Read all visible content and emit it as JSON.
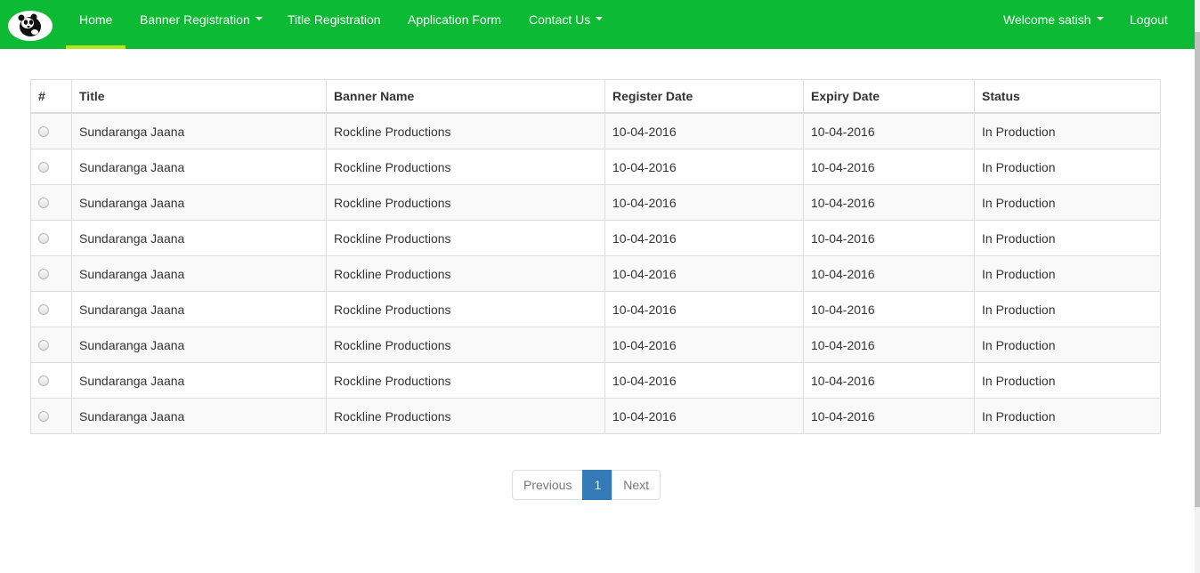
{
  "nav": {
    "logo_icon": "panda-logo-icon",
    "items": [
      {
        "label": "Home",
        "active": true
      },
      {
        "label": "Banner Registration",
        "dropdown": true
      },
      {
        "label": "Title Registration"
      },
      {
        "label": "Application Form"
      },
      {
        "label": "Contact Us",
        "dropdown": true
      }
    ],
    "welcome": "Welcome satish",
    "logout": "Logout",
    "colors": {
      "bar": "#0dba33",
      "active_underline": "#b5e61d"
    }
  },
  "table": {
    "headers": [
      "#",
      "Title",
      "Banner Name",
      "Register Date",
      "Expiry Date",
      "Status"
    ],
    "rows": [
      {
        "title": "Sundaranga Jaana",
        "banner": "Rockline Productions",
        "register_date": "10-04-2016",
        "expiry_date": "10-04-2016",
        "status": "In Production"
      },
      {
        "title": "Sundaranga Jaana",
        "banner": "Rockline Productions",
        "register_date": "10-04-2016",
        "expiry_date": "10-04-2016",
        "status": "In Production"
      },
      {
        "title": "Sundaranga Jaana",
        "banner": "Rockline Productions",
        "register_date": "10-04-2016",
        "expiry_date": "10-04-2016",
        "status": "In Production"
      },
      {
        "title": "Sundaranga Jaana",
        "banner": "Rockline Productions",
        "register_date": "10-04-2016",
        "expiry_date": "10-04-2016",
        "status": "In Production"
      },
      {
        "title": "Sundaranga Jaana",
        "banner": "Rockline Productions",
        "register_date": "10-04-2016",
        "expiry_date": "10-04-2016",
        "status": "In Production"
      },
      {
        "title": "Sundaranga Jaana",
        "banner": "Rockline Productions",
        "register_date": "10-04-2016",
        "expiry_date": "10-04-2016",
        "status": "In Production"
      },
      {
        "title": "Sundaranga Jaana",
        "banner": "Rockline Productions",
        "register_date": "10-04-2016",
        "expiry_date": "10-04-2016",
        "status": "In Production"
      },
      {
        "title": "Sundaranga Jaana",
        "banner": "Rockline Productions",
        "register_date": "10-04-2016",
        "expiry_date": "10-04-2016",
        "status": "In Production"
      },
      {
        "title": "Sundaranga Jaana",
        "banner": "Rockline Productions",
        "register_date": "10-04-2016",
        "expiry_date": "10-04-2016",
        "status": "In Production"
      }
    ]
  },
  "pagination": {
    "previous": "Previous",
    "current_page": "1",
    "next": "Next",
    "active_color": "#337ab7"
  }
}
